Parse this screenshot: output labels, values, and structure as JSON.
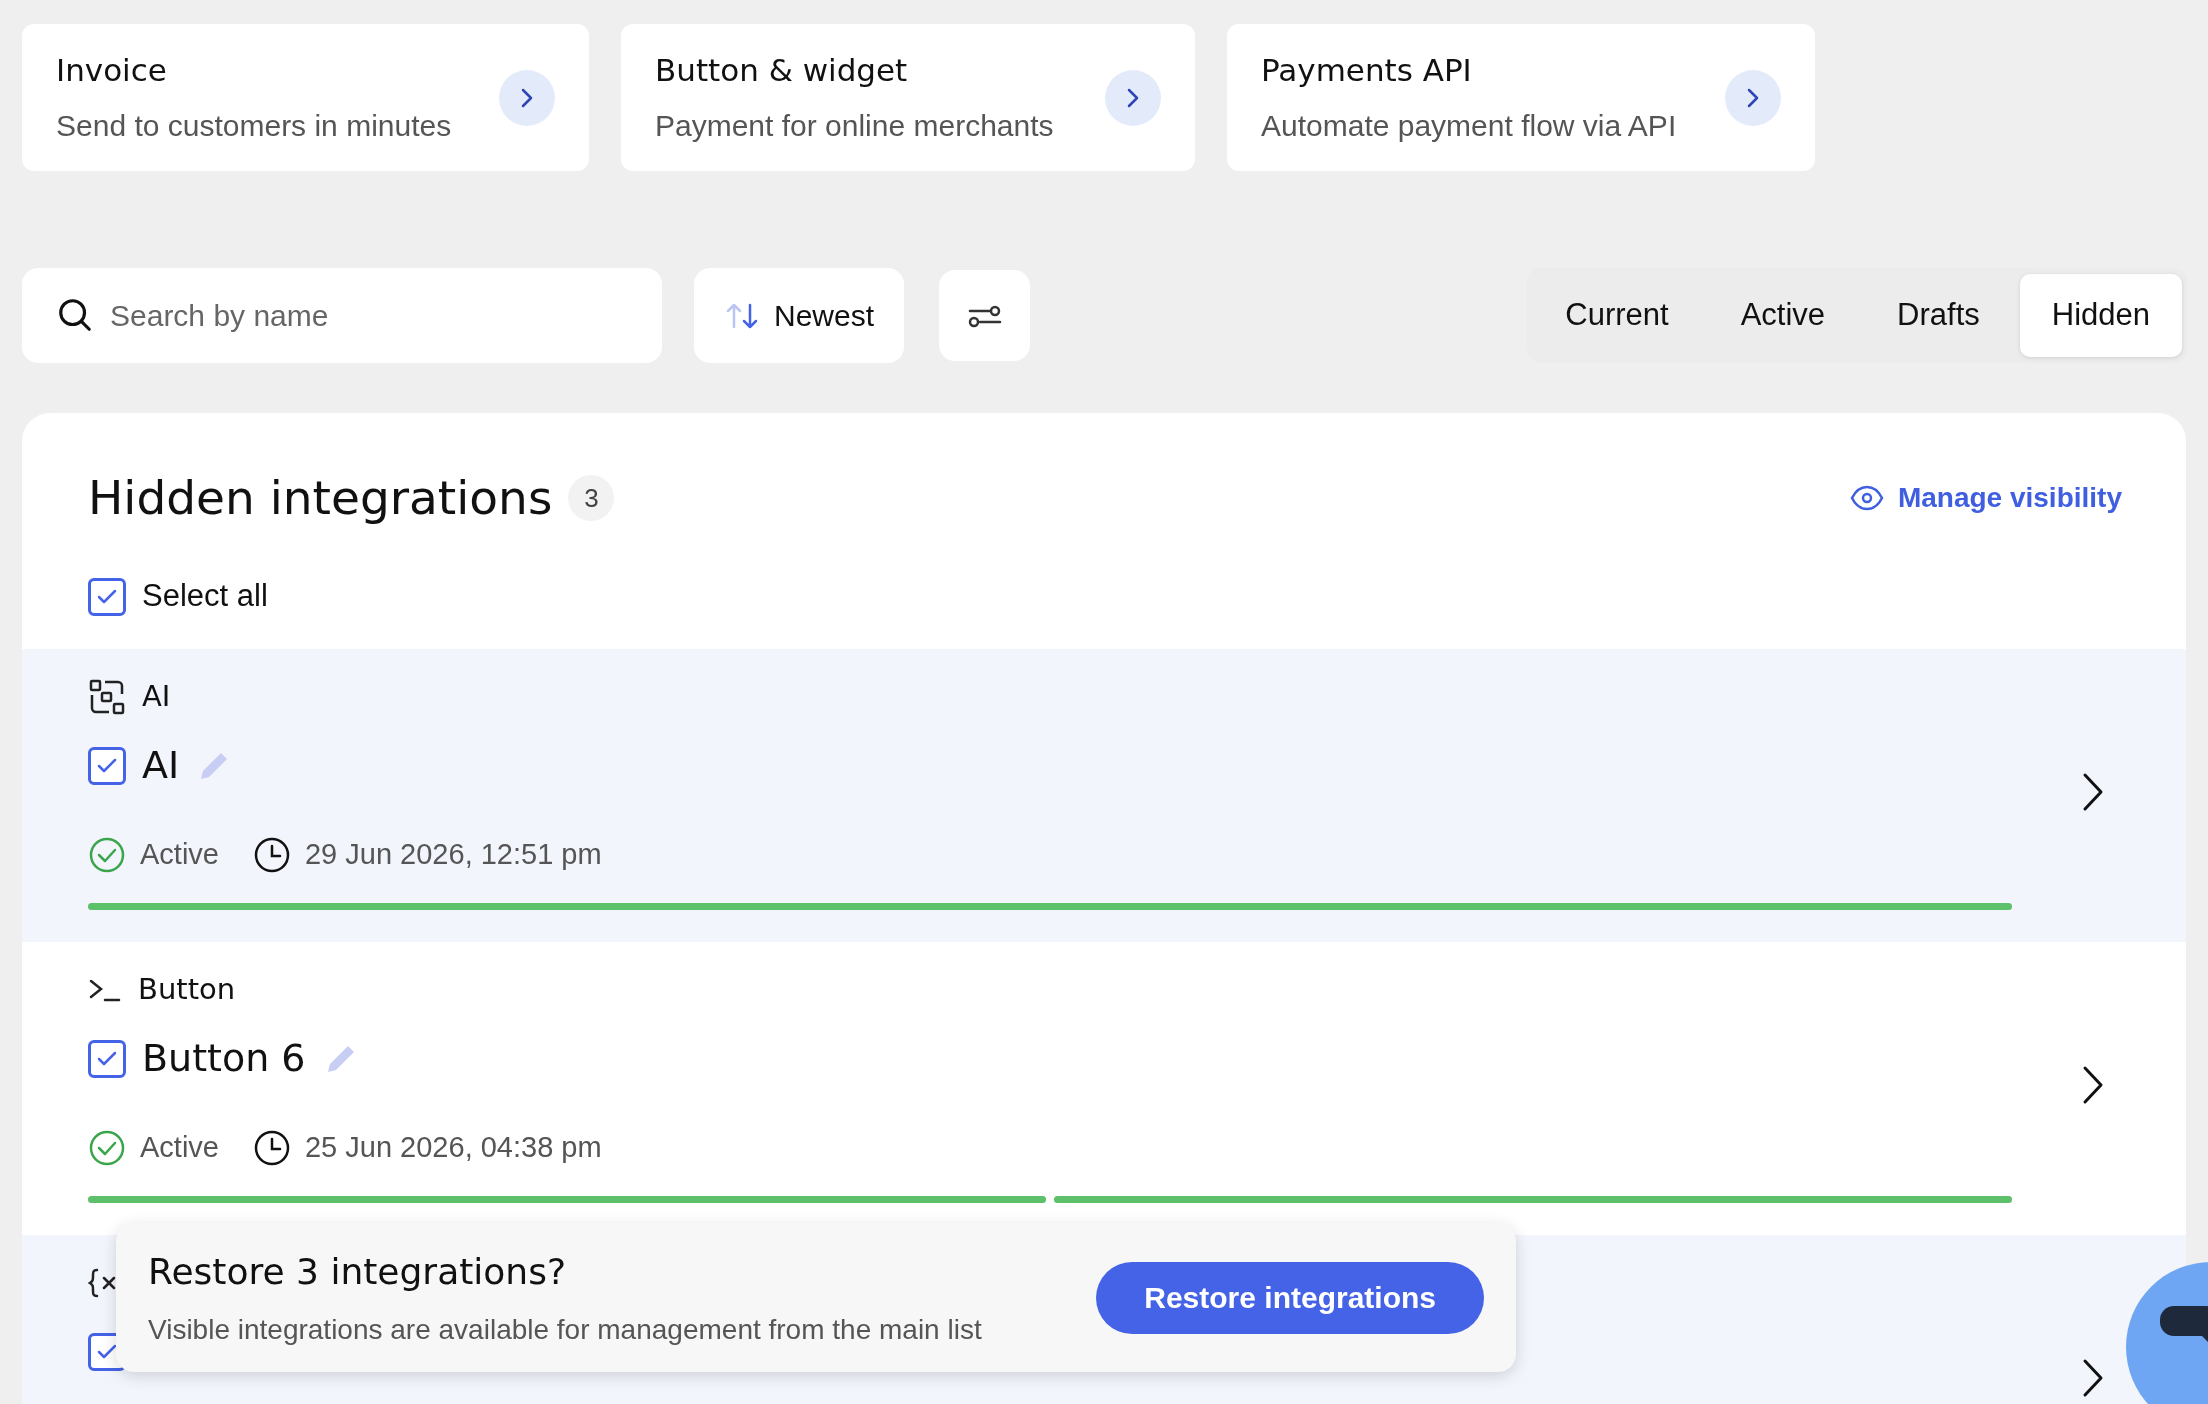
{
  "cards": [
    {
      "title": "Invoice",
      "subtitle": "Send to customers in minutes"
    },
    {
      "title": "Button & widget",
      "subtitle": "Payment for online merchants"
    },
    {
      "title": "Payments API",
      "subtitle": "Automate payment flow via API"
    }
  ],
  "search": {
    "placeholder": "Search by name"
  },
  "sort": {
    "label": "Newest"
  },
  "tabs": [
    {
      "label": "Current",
      "selected": false
    },
    {
      "label": "Active",
      "selected": false
    },
    {
      "label": "Drafts",
      "selected": false
    },
    {
      "label": "Hidden",
      "selected": true
    }
  ],
  "panel": {
    "title": "Hidden integrations",
    "count": "3",
    "manage_link": "Manage visibility",
    "select_all": {
      "label": "Select all",
      "checked": true
    },
    "rows": [
      {
        "kind": "ai",
        "category": "AI",
        "title": "AI",
        "checked": true,
        "status": "Active",
        "date": "29 Jun 2026, 12:51 pm",
        "highlighted": true,
        "segments": [
          {
            "level": 1
          }
        ]
      },
      {
        "kind": "terminal",
        "category": "Button",
        "title": "Button 6",
        "checked": true,
        "status": "Active",
        "date": "25 Jun 2026, 04:38 pm",
        "highlighted": false,
        "segments": [
          {
            "level": 1
          },
          {
            "level": 1
          }
        ]
      },
      {
        "kind": "variable",
        "checked": true,
        "highlighted": true
      }
    ]
  },
  "toast": {
    "title": "Restore 3 integrations?",
    "text": "Visible integrations are available for management from the main list",
    "button": "Restore integrations"
  }
}
